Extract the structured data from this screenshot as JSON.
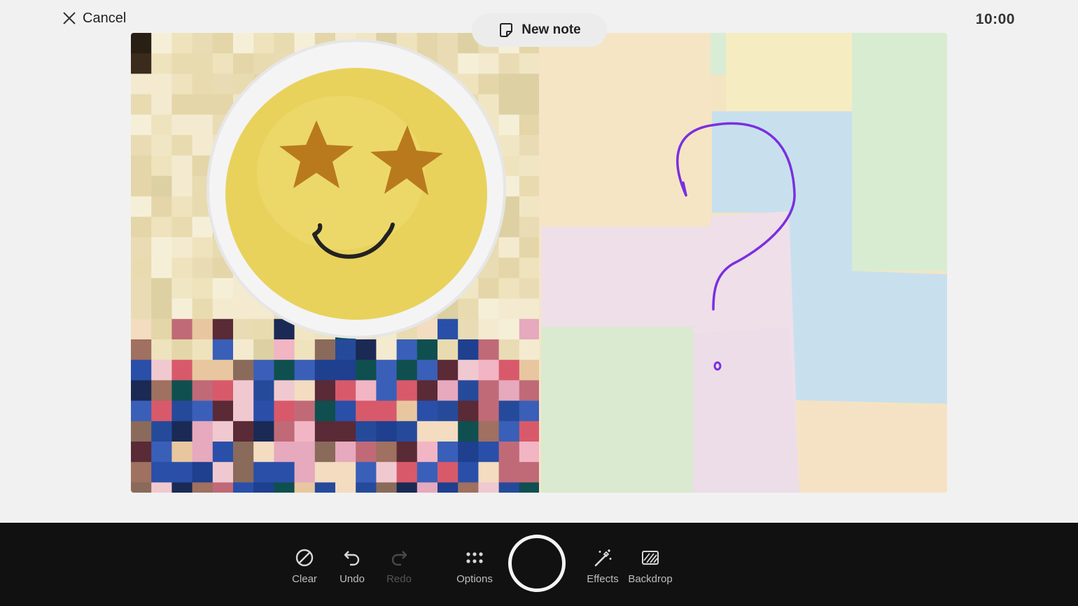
{
  "header": {
    "cancel_label": "Cancel",
    "cancel_icon": "close-icon",
    "new_note_label": "New note",
    "new_note_icon": "sticky-note-icon",
    "time": "10:00"
  },
  "canvas": {
    "left_panel": "pixelated-camera-feed",
    "sticker": "star-eyes-smiley-sticker",
    "right_panel": "sticky-notes-backdrop",
    "drawing": "purple-question-mark",
    "drawing_color": "#7b2fe0"
  },
  "toolbar": {
    "clear_label": "Clear",
    "undo_label": "Undo",
    "redo_label": "Redo",
    "options_label": "Options",
    "effects_label": "Effects",
    "backdrop_label": "Backdrop",
    "redo_enabled": false
  },
  "colors": {
    "background": "#f1f1f1",
    "toolbar_bg": "#111111",
    "shutter_ring": "#f4f4f4"
  }
}
